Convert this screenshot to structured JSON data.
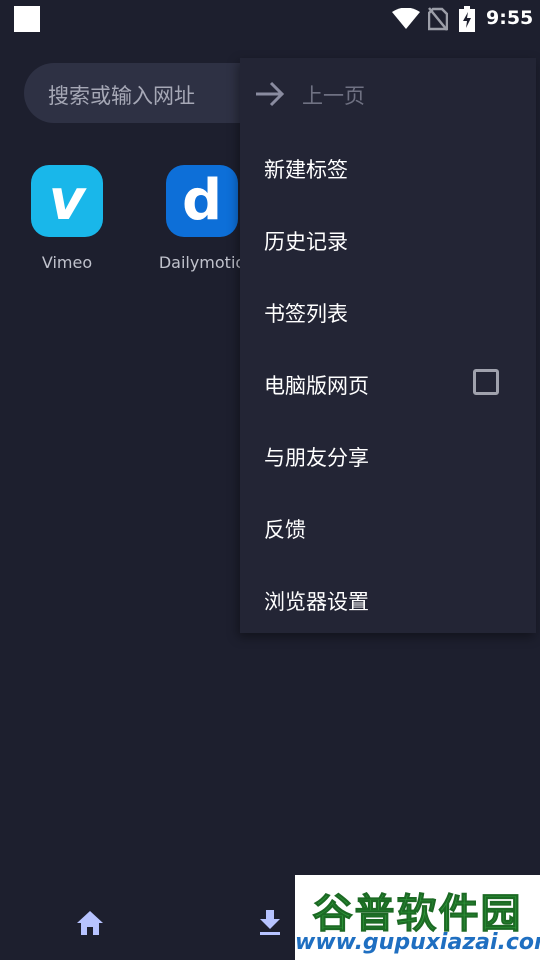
{
  "status_bar": {
    "time": "9:55",
    "icons": [
      "app-notification-icon",
      "wifi-icon",
      "no-sim-icon",
      "battery-charging-icon"
    ]
  },
  "search": {
    "placeholder": "搜索或输入网址"
  },
  "shortcuts": [
    {
      "label": "Vimeo",
      "glyph": "v",
      "color": "#19b7ea"
    },
    {
      "label": "Dailymotio",
      "glyph": "d",
      "color": "#0d6fd8"
    }
  ],
  "menu": {
    "back_label": "上一页",
    "items": [
      {
        "label": "新建标签"
      },
      {
        "label": "历史记录"
      },
      {
        "label": "书签列表"
      },
      {
        "label": "电脑版网页",
        "checkbox": false
      },
      {
        "label": "与朋友分享"
      },
      {
        "label": "反馈"
      },
      {
        "label": "浏览器设置"
      }
    ]
  },
  "bottom_bar": {
    "icons": [
      "home-icon",
      "download-icon",
      "tabs-icon"
    ]
  },
  "watermark": {
    "title": "谷普软件园",
    "url": "www.gupuxiazai.com"
  },
  "colors": {
    "background": "#1d1f2e",
    "menu_background": "#232535",
    "search_background": "#2e3144",
    "accent_icon": "#b7c3ff"
  }
}
